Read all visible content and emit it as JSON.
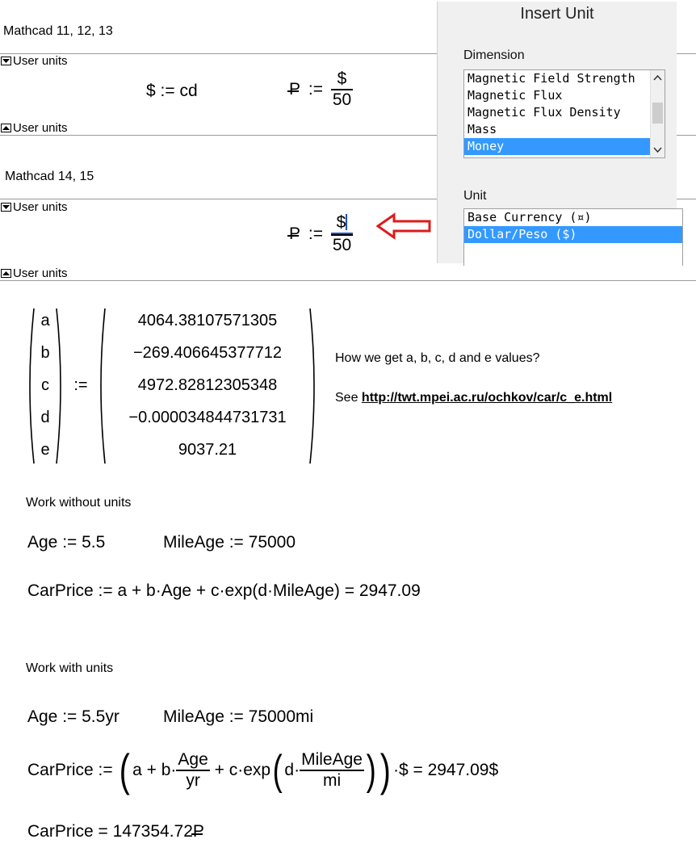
{
  "sections": {
    "old": {
      "title": "Mathcad 11, 12, 13",
      "region_top": "User units",
      "region_bottom": "User units"
    },
    "new": {
      "title": "Mathcad 14, 15",
      "region_top": "User units",
      "region_bottom": "User units"
    }
  },
  "defs": {
    "dollar_def": "$ := cd",
    "ruble_lhs": "P",
    "assign": ":=",
    "ruble_num": "$",
    "ruble_den": "50"
  },
  "dialog": {
    "title": "Insert Unit",
    "dimension_label": "Dimension",
    "dimension_items": [
      "Magnetic Field Strength",
      "Magnetic Flux",
      "Magnetic Flux Density",
      "Mass",
      "Money"
    ],
    "dimension_selected": "Money",
    "unit_label": "Unit",
    "unit_items": [
      "Base Currency (¤)",
      "Dollar/Peso ($)"
    ],
    "unit_selected": "Dollar/Peso ($)"
  },
  "matrix": {
    "vars": [
      "a",
      "b",
      "c",
      "d",
      "e"
    ],
    "values": [
      "4064.38107571305",
      "−269.406645377712",
      "4972.82812305348",
      "−0.000034844731731",
      "9037.21"
    ],
    "assign": ":="
  },
  "note": {
    "question": "How we get a, b, c, d and e values?",
    "see_prefix": "See",
    "url": "http://twt.mpei.ac.ru/ochkov/car/c_e.html"
  },
  "without_units": {
    "heading": "Work without units",
    "age": "Age := 5.5",
    "mileage": "MileAge := 75000",
    "price": "CarPrice := a + b·Age + c·exp(d·MileAge) = 2947.09"
  },
  "with_units": {
    "heading": "Work with units",
    "age": "Age := 5.5yr",
    "mileage": "MileAge := 75000mi",
    "price_lhs": "CarPrice :=",
    "price_a": "a + b·",
    "age_num": "Age",
    "age_den": "yr",
    "price_c": "+ c·exp",
    "price_d": "d·",
    "mile_num": "MileAge",
    "mile_den": "mi",
    "price_tail": "·$ = 2947.09$",
    "price_rub": "CarPrice = 147354.72"
  }
}
